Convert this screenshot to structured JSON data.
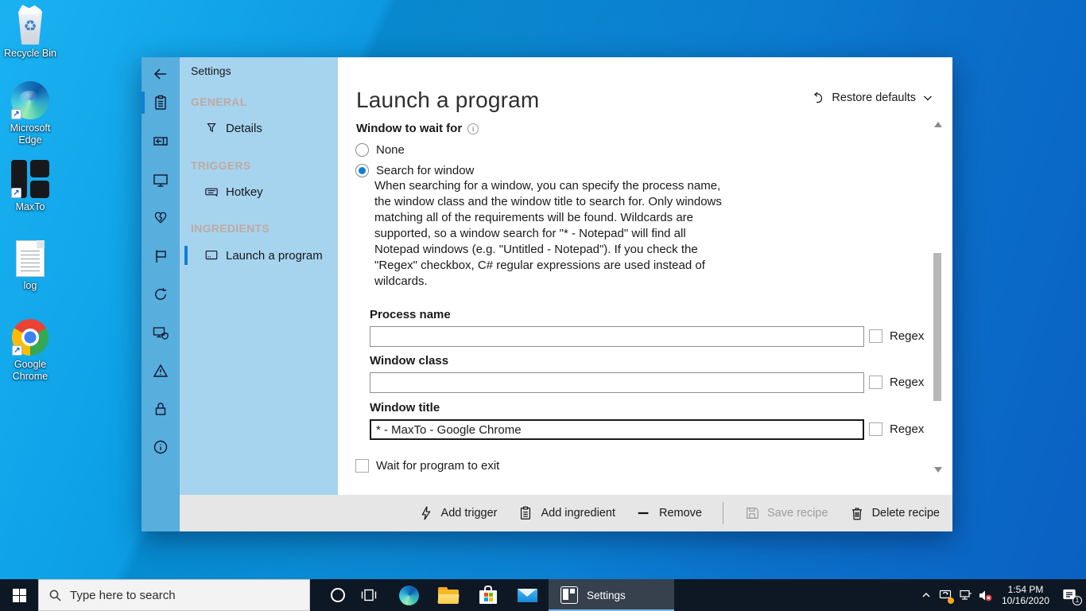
{
  "desktop": {
    "icons": [
      {
        "label": "Recycle Bin"
      },
      {
        "label": "Microsoft Edge"
      },
      {
        "label": "MaxTo"
      },
      {
        "label": "log"
      },
      {
        "label": "Google Chrome"
      }
    ]
  },
  "window": {
    "title": "Settings",
    "nav": {
      "sections": [
        {
          "label": "GENERAL"
        },
        {
          "label": "TRIGGERS"
        },
        {
          "label": "INGREDIENTS"
        }
      ],
      "items": [
        {
          "label": "Details"
        },
        {
          "label": "Hotkey"
        },
        {
          "label": "Launch a program"
        }
      ]
    },
    "content": {
      "heading": "Launch a program",
      "restore_defaults": "Restore defaults",
      "section_label": "Window to wait for",
      "radio_none": "None",
      "radio_search": "Search for window",
      "search_description": "When searching for a window, you can specify the process name, the window class and the window title to search for. Only windows matching all of the requirements will be found. Wildcards are supported, so a window search for \"* - Notepad\" will find all Notepad windows (e.g. \"Untitled - Notepad\"). If you check the \"Regex\" checkbox, C# regular expressions are used instead of wildcards.",
      "fields": [
        {
          "label": "Process name",
          "value": "",
          "regex_label": "Regex"
        },
        {
          "label": "Window class",
          "value": "",
          "regex_label": "Regex"
        },
        {
          "label": "Window title",
          "value": "* - MaxTo - Google Chrome",
          "regex_label": "Regex"
        }
      ],
      "wait_checkbox_label": "Wait for program to exit"
    },
    "toolbar": {
      "add_trigger": "Add trigger",
      "add_ingredient": "Add ingredient",
      "remove": "Remove",
      "save_recipe": "Save recipe",
      "delete_recipe": "Delete recipe"
    }
  },
  "taskbar": {
    "search_placeholder": "Type here to search",
    "active_task_label": "Settings",
    "tray": {
      "time": "1:54 PM",
      "date": "10/16/2020",
      "notification_count": "1"
    }
  },
  "colors": {
    "accent": "#0f7fd7",
    "rail_blue": "#58aedd",
    "panel_blue": "#a6d4ee",
    "taskbar_dark": "#0e1724",
    "desktop_blue": "#0b93dd",
    "task_underline": "#76b9ed"
  }
}
